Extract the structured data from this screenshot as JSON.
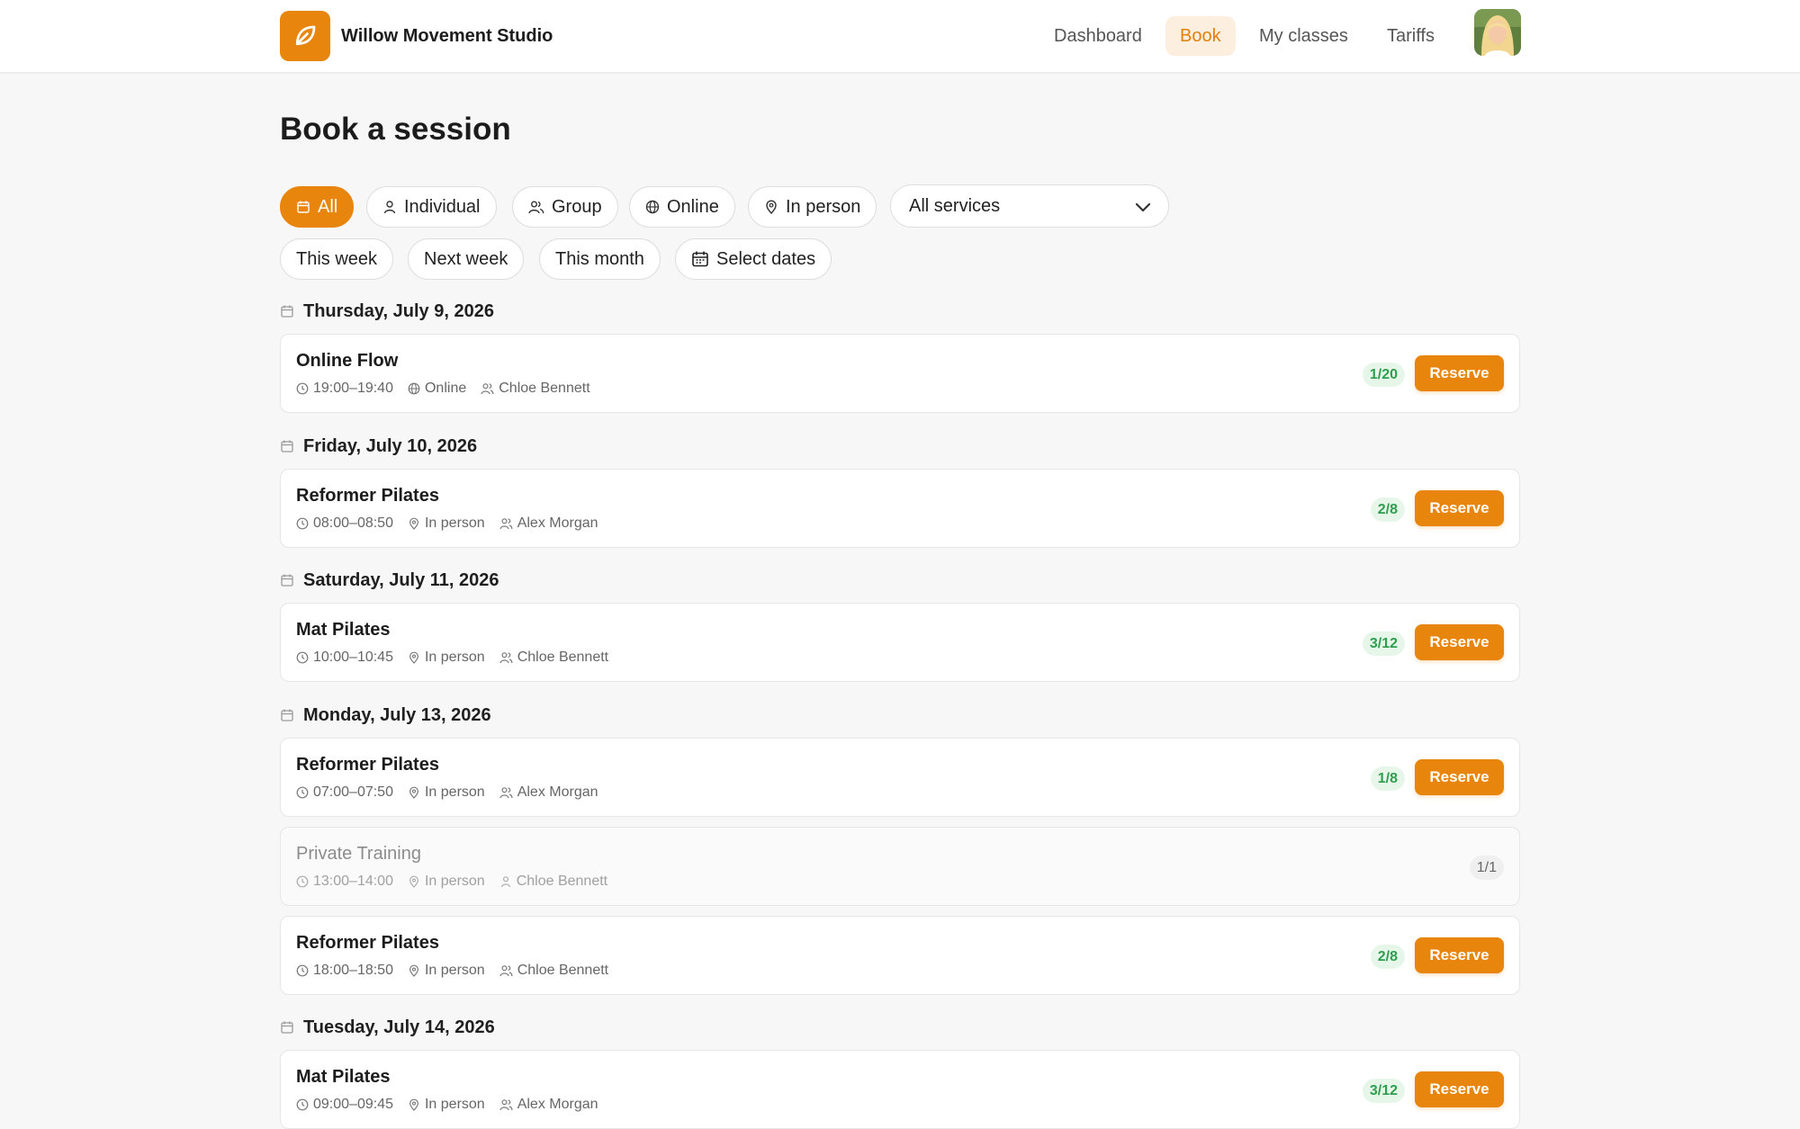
{
  "brand": {
    "name": "Willow Movement Studio",
    "accent": "#e8850c"
  },
  "nav": {
    "dashboard": "Dashboard",
    "book": "Book",
    "my_classes": "My classes",
    "tariffs": "Tariffs"
  },
  "page": {
    "title": "Book a session"
  },
  "filters": {
    "type": {
      "all": "All",
      "individual": "Individual",
      "group": "Group",
      "online": "Online",
      "in_person": "In person"
    },
    "services_select": "All services",
    "range": {
      "this_week": "This week",
      "next_week": "Next week",
      "this_month": "This month",
      "select_dates": "Select dates"
    }
  },
  "reserve_label": "Reserve",
  "days": [
    {
      "heading": "Thursday, July 9, 2026",
      "sessions": [
        {
          "title": "Online Flow",
          "time": "19:00–19:40",
          "mode": "Online",
          "instructor": "Chloe Bennett",
          "capacity": "1/20",
          "available": true
        }
      ]
    },
    {
      "heading": "Friday, July 10, 2026",
      "sessions": [
        {
          "title": "Reformer Pilates",
          "time": "08:00–08:50",
          "mode": "In person",
          "instructor": "Alex Morgan",
          "capacity": "2/8",
          "available": true
        }
      ]
    },
    {
      "heading": "Saturday, July 11, 2026",
      "sessions": [
        {
          "title": "Mat Pilates",
          "time": "10:00–10:45",
          "mode": "In person",
          "instructor": "Chloe Bennett",
          "capacity": "3/12",
          "available": true
        }
      ]
    },
    {
      "heading": "Monday, July 13, 2026",
      "sessions": [
        {
          "title": "Reformer Pilates",
          "time": "07:00–07:50",
          "mode": "In person",
          "instructor": "Alex Morgan",
          "capacity": "1/8",
          "available": true
        },
        {
          "title": "Private Training",
          "time": "13:00–14:00",
          "mode": "In person",
          "instructor": "Chloe Bennett",
          "capacity": "1/1",
          "available": false
        },
        {
          "title": "Reformer Pilates",
          "time": "18:00–18:50",
          "mode": "In person",
          "instructor": "Chloe Bennett",
          "capacity": "2/8",
          "available": true
        }
      ]
    },
    {
      "heading": "Tuesday, July 14, 2026",
      "sessions": [
        {
          "title": "Mat Pilates",
          "time": "09:00–09:45",
          "mode": "In person",
          "instructor": "Alex Morgan",
          "capacity": "3/12",
          "available": true
        }
      ]
    }
  ]
}
